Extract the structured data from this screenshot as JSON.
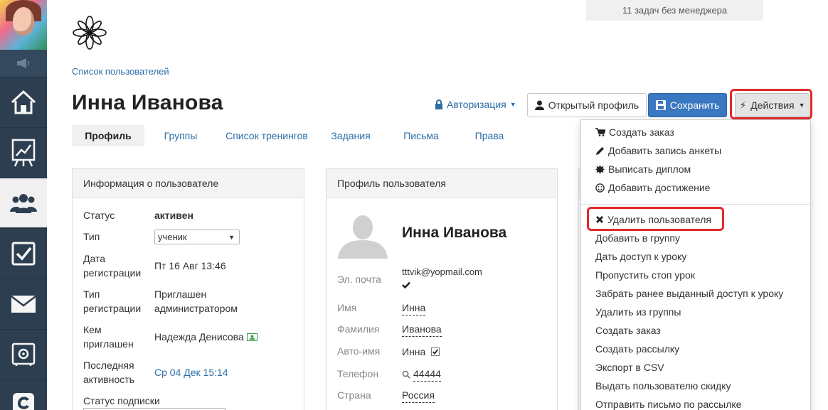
{
  "banner": {
    "tasks": "11 задач без менеджера"
  },
  "breadcrumb": "Список пользователей",
  "title": "Инна Иванова",
  "header": {
    "auth": "Авторизация",
    "open_profile": "Открытый профиль",
    "save": "Сохранить",
    "actions": "Действия"
  },
  "tabs": [
    "Профиль",
    "Группы",
    "Список тренингов",
    "Задания",
    "Письма",
    "Права"
  ],
  "info": {
    "heading": "Информация о пользователе",
    "status_label": "Статус",
    "status_value": "активен",
    "type_label": "Тип",
    "type_value": "ученик",
    "reg_date_label_1": "Дата",
    "reg_date_label_2": "регистрации",
    "reg_date_value": "Пт 16 Авг 13:46",
    "reg_type_label_1": "Тип",
    "reg_type_label_2": "регистрации",
    "reg_type_value_1": "Приглашен",
    "reg_type_value_2": "администратором",
    "invited_label_1": "Кем",
    "invited_label_2": "приглашен",
    "invited_value": "Надежда Денисова",
    "last_label_1": "Последняя",
    "last_label_2": "активность",
    "last_value": "Ср 04 Дек 15:14",
    "sub_label": "Статус подписки"
  },
  "profile": {
    "heading": "Профиль пользователя",
    "name": "Инна Иванова",
    "email_label": "Эл. почта",
    "email_value": "tttvik@yopmail.com",
    "first_label": "Имя",
    "first_value": "Инна",
    "last_label": "Фамилия",
    "last_value": "Иванова",
    "auto_label": "Авто-имя",
    "auto_value": "Инна",
    "phone_label": "Телефон",
    "phone_value": "44444",
    "country_label": "Страна",
    "country_value": "Россия"
  },
  "actions_menu": {
    "group1": [
      "Создать заказ",
      "Добавить запись анкеты",
      "Выписать диплом",
      "Добавить достижение"
    ],
    "delete": "Удалить пользователя",
    "group2": [
      "Добавить в группу",
      "Дать доступ к уроку",
      "Пропустить стоп урок",
      "Забрать ранее выданный доступ к уроку",
      "Удалить из группы",
      "Создать заказ",
      "Создать рассылку",
      "Экспорт в CSV",
      "Выдать пользователю скидку",
      "Отправить письмо по рассылке"
    ]
  },
  "colors": {
    "link": "#2b6ea8",
    "primary": "#3a78c2",
    "sidebar": "#2c3e50",
    "highlight": "#e02a2a"
  }
}
